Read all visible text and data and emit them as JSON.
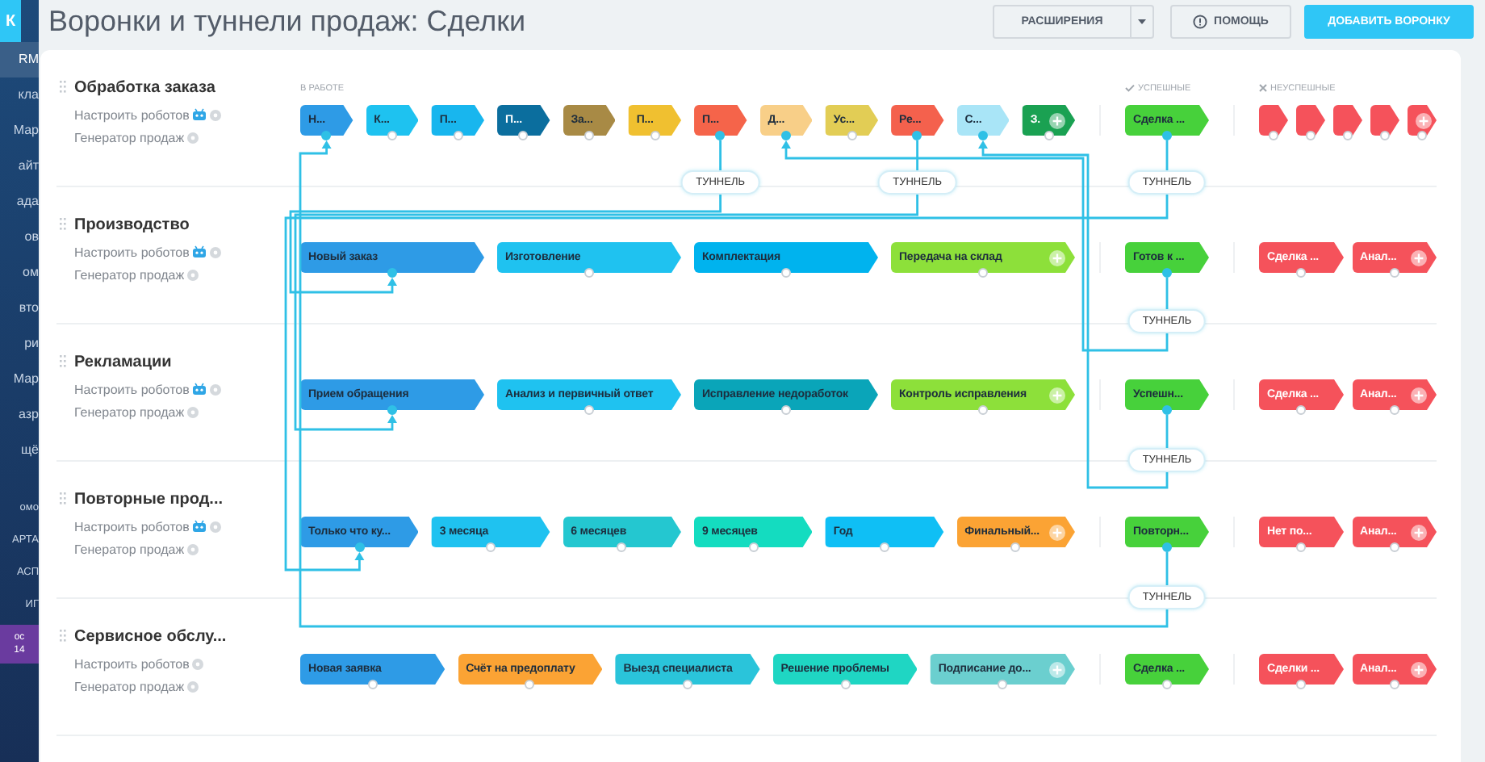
{
  "sidebar": {
    "logo": "К",
    "items": [
      {
        "label": "RM",
        "selected": true
      },
      {
        "label": "кла",
        "selected": false
      },
      {
        "label": "Мар",
        "selected": false
      },
      {
        "label": "айт",
        "selected": false
      },
      {
        "label": "ада",
        "selected": false
      },
      {
        "label": "ов",
        "selected": false
      },
      {
        "label": "ом",
        "selected": false
      },
      {
        "label": "вто",
        "selected": false
      },
      {
        "label": "ри",
        "selected": false
      },
      {
        "label": "Мар",
        "selected": false
      },
      {
        "label": "азр",
        "selected": false
      },
      {
        "label": "щё",
        "selected": false
      }
    ],
    "lower_items": [
      "омо",
      "АРТА",
      "АСП",
      "ИГ"
    ],
    "badge": [
      "ос",
      "14"
    ]
  },
  "header": {
    "title": "Воронки и туннели продаж: Сделки",
    "buttons": [
      {
        "kind": "split",
        "label": "РАСШИРЕНИЯ"
      },
      {
        "kind": "help",
        "label": "ПОМОЩЬ"
      },
      {
        "kind": "primary",
        "label": "ДОБАВИТЬ ВОРОНКУ"
      }
    ]
  },
  "funnels": [
    {
      "name": "Обработка заказа",
      "robots_link": "Настроить роботов",
      "robots_active": true,
      "generator_link": "Генератор продаж",
      "groups": [
        {
          "kind": "in_progress",
          "label": "В РАБОТЕ",
          "stages": [
            {
              "name": "Н...",
              "color": "#2e9be6",
              "linked": true
            },
            {
              "name": "К...",
              "color": "#1ec2f0",
              "linked": false
            },
            {
              "name": "П...",
              "color": "#18b6ee",
              "linked": false
            },
            {
              "name": "П...",
              "color": "#0b6e9e",
              "linked": false
            },
            {
              "name": "За...",
              "color": "#a88a45",
              "linked": false
            },
            {
              "name": "П...",
              "color": "#f0c030",
              "linked": false
            },
            {
              "name": "П...",
              "color": "#f5644a",
              "linked": true
            },
            {
              "name": "Д...",
              "color": "#f8cf88",
              "linked": true
            },
            {
              "name": "Ус...",
              "color": "#e2cd55",
              "linked": false
            },
            {
              "name": "Ре...",
              "color": "#f4614d",
              "linked": true
            },
            {
              "name": "С...",
              "color": "#a9e5f7",
              "linked": true
            },
            {
              "name": "З.",
              "color": "#1aa152",
              "linked": false
            }
          ]
        },
        {
          "kind": "success",
          "label": "УСПЕШНЫЕ",
          "stages": [
            {
              "name": "Сделка ...",
              "color": "#47d13b",
              "linked": true
            }
          ]
        },
        {
          "kind": "failure",
          "label": "НЕУСПЕШНЫЕ",
          "stages": [
            {
              "color": "#f5525b",
              "linked": false
            },
            {
              "color": "#f5525b",
              "linked": false
            },
            {
              "color": "#f5525b",
              "linked": false
            },
            {
              "color": "#f5525b",
              "linked": false
            },
            {
              "color": "#f5525b",
              "linked": false
            }
          ]
        }
      ]
    },
    {
      "name": "Производство",
      "robots_link": "Настроить роботов",
      "robots_active": true,
      "generator_link": "Генератор продаж",
      "groups": [
        {
          "kind": "in_progress",
          "stages": [
            {
              "name": "Новый заказ",
              "color": "#2e9be6",
              "linked": true
            },
            {
              "name": "Изготовление",
              "color": "#1fc2f0",
              "linked": false
            },
            {
              "name": "Комплектация",
              "color": "#00b3ee",
              "linked": false
            },
            {
              "name": "Передача на склад",
              "color": "#8de03a",
              "linked": false
            }
          ]
        },
        {
          "kind": "success",
          "stages": [
            {
              "name": "Готов к ...",
              "color": "#47d13b",
              "linked": true
            }
          ]
        },
        {
          "kind": "failure",
          "stages": [
            {
              "name": "Сделка ...",
              "color": "#f5525b",
              "linked": false
            },
            {
              "name": "Анал...",
              "color": "#f5525b",
              "linked": false
            }
          ]
        }
      ]
    },
    {
      "name": "Рекламации",
      "robots_link": "Настроить роботов",
      "robots_active": true,
      "generator_link": "Генератор продаж",
      "groups": [
        {
          "kind": "in_progress",
          "stages": [
            {
              "name": "Прием обращения",
              "color": "#2e9be6",
              "linked": true
            },
            {
              "name": "Анализ и первичный ответ",
              "color": "#1fc2f0",
              "linked": false
            },
            {
              "name": "Исправление недоработок",
              "color": "#0aa5b9",
              "linked": false
            },
            {
              "name": "Контроль исправления",
              "color": "#8de03a",
              "linked": false
            }
          ]
        },
        {
          "kind": "success",
          "stages": [
            {
              "name": "Успешн...",
              "color": "#47d13b",
              "linked": true
            }
          ]
        },
        {
          "kind": "failure",
          "stages": [
            {
              "name": "Сделка ...",
              "color": "#f5525b",
              "linked": false
            },
            {
              "name": "Анал...",
              "color": "#f5525b",
              "linked": false
            }
          ]
        }
      ]
    },
    {
      "name": "Повторные прод...",
      "robots_link": "Настроить роботов",
      "robots_active": true,
      "generator_link": "Генератор продаж",
      "groups": [
        {
          "kind": "in_progress",
          "stages": [
            {
              "name": "Только что ку...",
              "color": "#2e9be6",
              "linked": true
            },
            {
              "name": "3 месяца",
              "color": "#1fc2f0",
              "linked": false
            },
            {
              "name": "6 месяцев",
              "color": "#24c7d0",
              "linked": false
            },
            {
              "name": "9 месяцев",
              "color": "#14dcc0",
              "linked": false
            },
            {
              "name": "Год",
              "color": "#0fbff5",
              "linked": false
            },
            {
              "name": "Финальный...",
              "color": "#fba334",
              "linked": false
            }
          ]
        },
        {
          "kind": "success",
          "stages": [
            {
              "name": "Повторн...",
              "color": "#47d13b",
              "linked": true
            }
          ]
        },
        {
          "kind": "failure",
          "stages": [
            {
              "name": "Нет по...",
              "color": "#f5525b",
              "linked": false
            },
            {
              "name": "Анал...",
              "color": "#f5525b",
              "linked": false
            }
          ]
        }
      ]
    },
    {
      "name": "Сервисное обслу...",
      "robots_link": "Настроить роботов",
      "robots_active": false,
      "generator_link": "Генератор продаж",
      "groups": [
        {
          "kind": "in_progress",
          "stages": [
            {
              "name": "Новая заявка",
              "color": "#2e9be6",
              "linked": false
            },
            {
              "name": "Счёт на предоплату",
              "color": "#fba334",
              "linked": false
            },
            {
              "name": "Выезд специалиста",
              "color": "#2ac4da",
              "linked": false
            },
            {
              "name": "Решение проблемы",
              "color": "#1fd6c3",
              "linked": false
            },
            {
              "name": "Подписание до...",
              "color": "#6bcfcf",
              "linked": false
            }
          ]
        },
        {
          "kind": "success",
          "stages": [
            {
              "name": "Сделка ...",
              "color": "#47d13b",
              "linked": false
            }
          ]
        },
        {
          "kind": "failure",
          "stages": [
            {
              "name": "Сделки ...",
              "color": "#f5525b",
              "linked": false
            },
            {
              "name": "Анал...",
              "color": "#f5525b",
              "linked": false
            }
          ]
        }
      ]
    }
  ],
  "tunnels": [
    {
      "label": "ТУННЕЛЬ"
    },
    {
      "label": "ТУННЕЛЬ"
    },
    {
      "label": "ТУННЕЛЬ"
    },
    {
      "label": "ТУННЕЛЬ"
    },
    {
      "label": "ТУННЕЛЬ"
    },
    {
      "label": "ТУННЕЛЬ"
    }
  ]
}
